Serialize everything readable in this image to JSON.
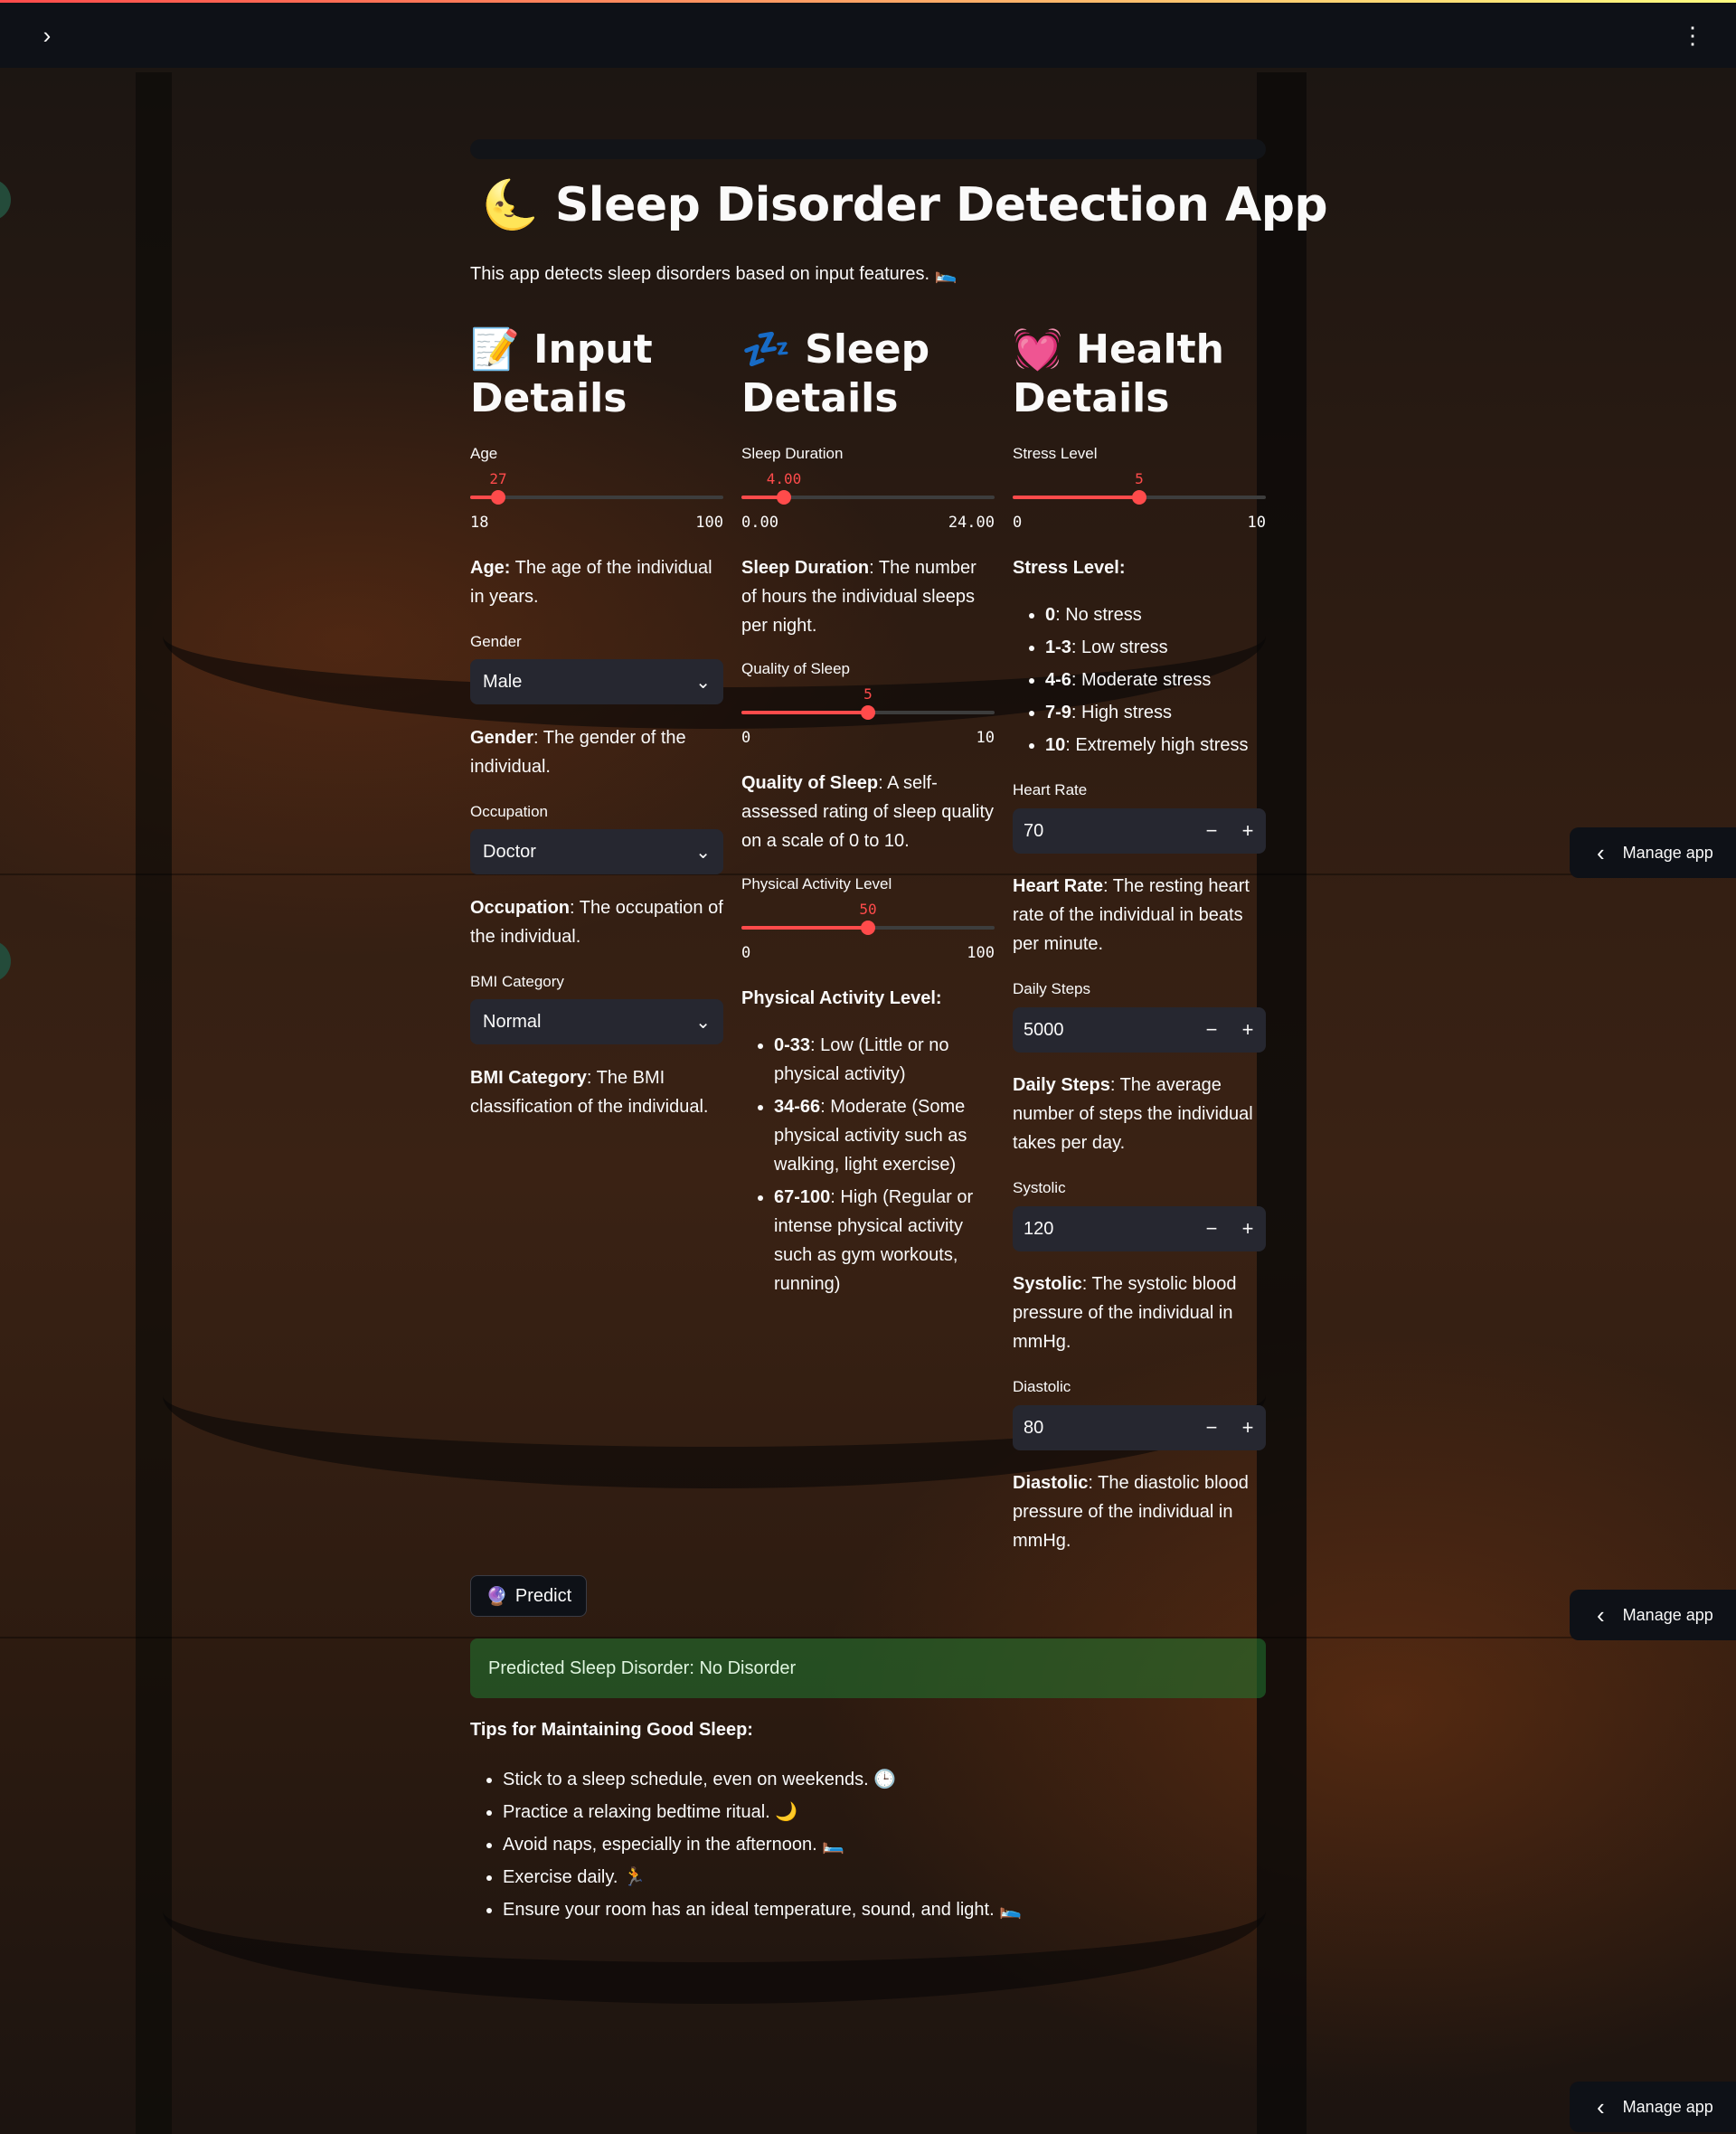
{
  "header": {
    "sidebar_toggle_icon": "›",
    "menu_icon": "⋮"
  },
  "title": {
    "emoji": "🌜",
    "text": "Sleep Disorder Detection App"
  },
  "intro": {
    "text": "This app detects sleep disorders based on input features.",
    "emoji": "🛌"
  },
  "columns": {
    "input": {
      "emoji": "📝",
      "title_line1": "Input",
      "title_line2": "Details"
    },
    "sleep": {
      "emoji": "💤",
      "title_line1": "Sleep",
      "title_line2": "Details"
    },
    "health": {
      "emoji": "💓",
      "title_line1": "Health",
      "title_line2": "Details"
    }
  },
  "age": {
    "label": "Age",
    "value": "27",
    "min": "18",
    "max": "100",
    "desc_bold": "Age:",
    "desc": " The age of the individual in years."
  },
  "gender": {
    "label": "Gender",
    "value": "Male",
    "desc_bold": "Gender",
    "desc": ": The gender of the individual."
  },
  "occupation": {
    "label": "Occupation",
    "value": "Doctor",
    "desc_bold": "Occupation",
    "desc": ": The occupation of the individual."
  },
  "bmi": {
    "label": "BMI Category",
    "value": "Normal",
    "desc_bold": "BMI Category",
    "desc": ": The BMI classification of the individual."
  },
  "sleep_duration": {
    "label": "Sleep Duration",
    "value": "4.00",
    "min": "0.00",
    "max": "24.00",
    "desc_bold": "Sleep Duration",
    "desc": ": The number of hours the individual sleeps per night."
  },
  "quality": {
    "label": "Quality of Sleep",
    "value": "5",
    "min": "0",
    "max": "10",
    "desc_bold": "Quality of Sleep",
    "desc": ": A self-assessed rating of sleep quality on a scale of 0 to 10."
  },
  "activity": {
    "label": "Physical Activity Level",
    "value": "50",
    "min": "0",
    "max": "100",
    "heading": "Physical Activity Level:",
    "items": [
      {
        "bold": "0-33",
        "text": ": Low (Little or no physical activity)"
      },
      {
        "bold": "34-66",
        "text": ": Moderate (Some physical activity such as walking, light exercise)"
      },
      {
        "bold": "67-100",
        "text": ": High (Regular or intense physical activity such as gym workouts, running)"
      }
    ]
  },
  "stress": {
    "label": "Stress Level",
    "value": "5",
    "min": "0",
    "max": "10",
    "heading": "Stress Level:",
    "items": [
      {
        "bold": "0",
        "text": ": No stress"
      },
      {
        "bold": "1-3",
        "text": ": Low stress"
      },
      {
        "bold": "4-6",
        "text": ": Moderate stress"
      },
      {
        "bold": "7-9",
        "text": ": High stress"
      },
      {
        "bold": "10",
        "text": ": Extremely high stress"
      }
    ]
  },
  "heart_rate": {
    "label": "Heart Rate",
    "value": "70",
    "desc_bold": "Heart Rate",
    "desc": ": The resting heart rate of the individual in beats per minute."
  },
  "daily_steps": {
    "label": "Daily Steps",
    "value": "5000",
    "desc_bold": "Daily Steps",
    "desc": ": The average number of steps the individual takes per day."
  },
  "systolic": {
    "label": "Systolic",
    "value": "120",
    "desc_bold": "Systolic",
    "desc": ": The systolic blood pressure of the individual in mmHg."
  },
  "diastolic": {
    "label": "Diastolic",
    "value": "80",
    "desc_bold": "Diastolic",
    "desc": ": The diastolic blood pressure of the individual in mmHg."
  },
  "stepper": {
    "minus": "−",
    "plus": "+"
  },
  "select_chevron": "⌄",
  "predict": {
    "emoji": "🔮",
    "label": "Predict"
  },
  "result": {
    "text": "Predicted Sleep Disorder: No Disorder"
  },
  "tips": {
    "heading": "Tips for Maintaining Good Sleep:",
    "items": [
      "Stick to a sleep schedule, even on weekends. 🕒",
      "Practice a relaxing bedtime ritual. 🌙",
      "Avoid naps, especially in the afternoon. 🛏️",
      "Exercise daily. 🏃",
      "Ensure your room has an ideal temperature, sound, and light. 🛌"
    ]
  },
  "manage_app": {
    "icon": "‹",
    "label": "Manage app"
  },
  "levels": {
    "age": 0.11,
    "sleep_duration": 0.167,
    "quality": 0.5,
    "activity": 0.5,
    "stress": 0.5
  }
}
